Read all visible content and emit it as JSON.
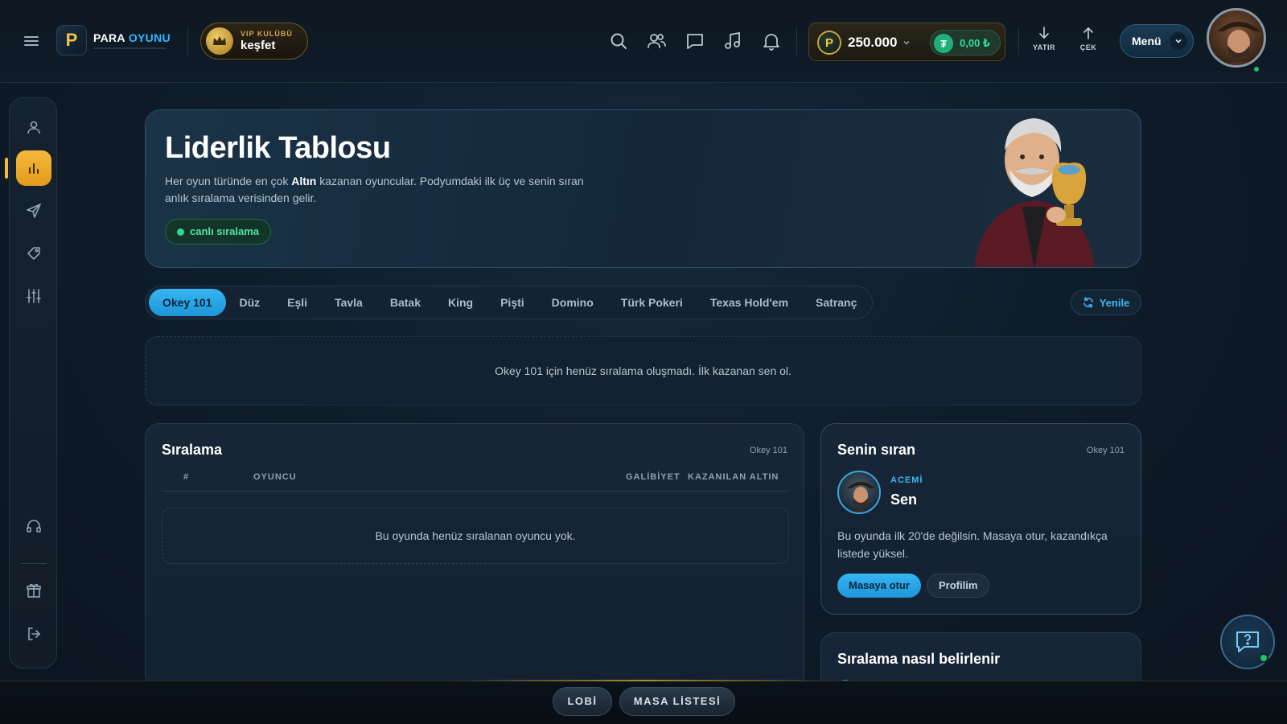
{
  "header": {
    "logo_word1": "PARA",
    "logo_word2": "OYUNU",
    "logo_mark": "P",
    "vip_top": "VIP KULÜBÜ",
    "vip_bottom": "keşfet",
    "icons": [
      "search-icon",
      "users-icon",
      "chat-icon",
      "music-icon",
      "bell-icon"
    ],
    "coin_symbol": "P",
    "coin_balance": "250.000",
    "tl_symbol": "₮",
    "tl_balance": "0,00 ₺",
    "deposit_label": "YATIR",
    "withdraw_label": "ÇEK",
    "menu_label": "Menü"
  },
  "sidebar": {
    "items": [
      "profile-icon",
      "leaderboard-icon",
      "send-icon",
      "tag-icon",
      "sliders-icon",
      "headset-icon",
      "gift-icon",
      "logout-icon"
    ],
    "active": "leaderboard-icon"
  },
  "hero": {
    "title": "Liderlik Tablosu",
    "desc_before": "Her oyun türünde en çok ",
    "desc_bold": "Altın",
    "desc_after": " kazanan oyuncular. Podyumdaki ilk üç ve senin sıran anlık sıralama verisinden gelir.",
    "live_label": "canlı sıralama"
  },
  "tabs": {
    "items": [
      "Okey 101",
      "Düz",
      "Eşli",
      "Tavla",
      "Batak",
      "King",
      "Pişti",
      "Domino",
      "Türk Pokeri",
      "Texas Hold'em",
      "Satranç"
    ],
    "active_index": 0,
    "refresh_label": "Yenile"
  },
  "notice": "Okey 101 için henüz sıralama oluşmadı. İlk kazanan sen ol.",
  "ranking": {
    "title": "Sıralama",
    "tag": "Okey 101",
    "columns": [
      "#",
      "OYUNCU",
      "GALİBİYET",
      "KAZANILAN ALTIN"
    ],
    "empty": "Bu oyunda henüz sıralanan oyuncu yok."
  },
  "my_rank": {
    "title": "Senin sıran",
    "tag": "Okey 101",
    "level": "ACEMİ",
    "name": "Sen",
    "desc": "Bu oyunda ilk 20'de değilsin. Masaya otur, kazandıkça listede yüksel.",
    "primary_button": "Masaya otur",
    "secondary_button": "Profilim"
  },
  "how": {
    "title": "Sıralama nasıl belirlenir"
  },
  "bottom": {
    "lobby": "LOBİ",
    "tables": "MASA LİSTESİ"
  },
  "colors": {
    "accent_blue": "#36b6f3",
    "accent_gold": "#f6b93b",
    "live_green": "#2fd98e",
    "bg": "#0f1c2a"
  }
}
